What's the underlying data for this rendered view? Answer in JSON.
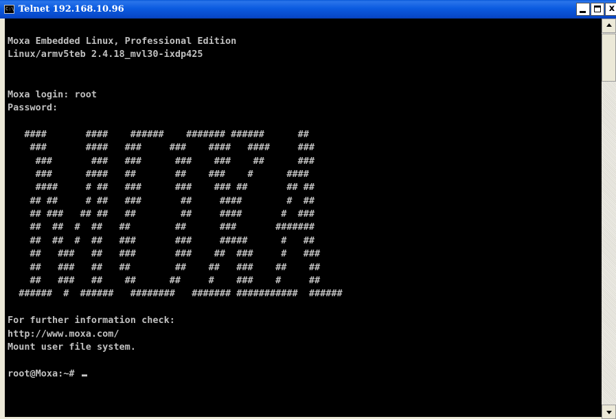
{
  "window": {
    "title": "Telnet 192.168.10.96",
    "app_icon": "console-icon",
    "icon_glyph": "C:\\",
    "buttons": {
      "minimize": "minimize-icon",
      "maximize": "maximize-icon",
      "close": "close-icon",
      "close_glyph": "x"
    }
  },
  "colors": {
    "title_bar": "#0b5be0",
    "console_bg": "#000000",
    "console_text": "#c0c0c0"
  },
  "console": {
    "header_lines": [
      "Moxa Embedded Linux, Professional Edition",
      "Linux/armv5teb 2.4.18_mvl30-ixdp425",
      "",
      "",
      "Moxa login: root",
      "Password:"
    ],
    "banner_lines": [
      "",
      "   ####       ####    ######    ####### ######      ##",
      "    ###       ####   ###     ###    ####   ####     ###",
      "     ###       ###   ###      ###    ###    ##      ###",
      "     ###      ####   ##       ##    ###    #      ####",
      "     ####     # ##   ###      ###    ### ##       ## ##",
      "    ## ##     # ##   ###       ##     ####        #  ##",
      "    ## ###   ## ##   ##        ##     ####       #  ###",
      "    ##  ##  #  ##   ##        ##      ###       #######",
      "    ##  ##  #  ##   ###       ###     #####      #   ##",
      "    ##   ###   ##   ###       ###    ##  ###     #   ###",
      "    ##   ###   ##   ##        ##    ##   ###    ##    ##",
      "    ##   ###   ##    ##      ##     #    ###    #     ##",
      "  ######  #  ######   ########   ####### ###########  ######"
    ],
    "footer_lines": [
      "",
      "For further information check:",
      "http://www.moxa.com/",
      "Mount user file system.",
      ""
    ],
    "prompt": "root@Moxa:~#"
  },
  "scrollbar": {
    "up_arrow": "scroll-up-icon",
    "down_arrow": "scroll-down-icon"
  }
}
